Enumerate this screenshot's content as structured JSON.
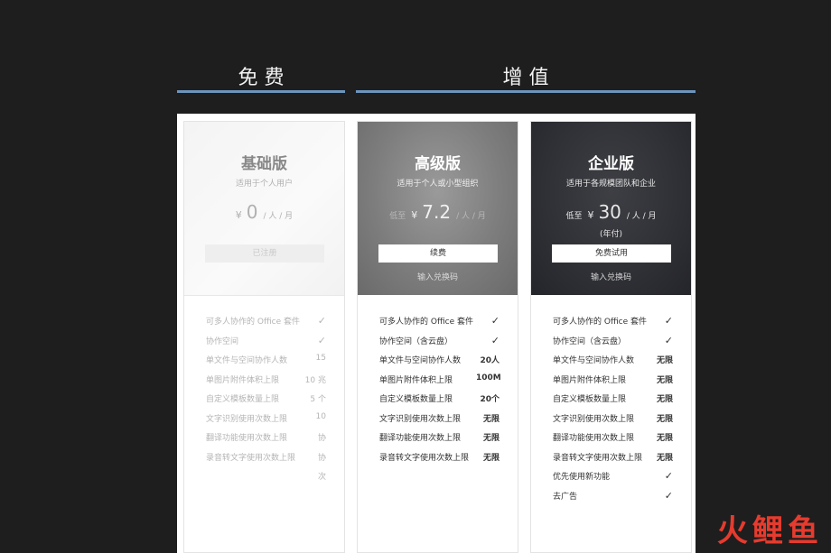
{
  "sections": {
    "free": "免  费",
    "value_added": "增  值"
  },
  "plans": [
    {
      "name": "基础版",
      "subtitle": "适用于个人用户",
      "prefix": "",
      "currency": "¥",
      "price": "0",
      "unit": "/ 人 / 月",
      "billing": "",
      "button": "已注册",
      "link": "",
      "features": [
        {
          "label": "可多人协作的 Office 套件",
          "value": "✓"
        },
        {
          "label": "协作空间",
          "value": "✓"
        },
        {
          "label": "单文件与空间协作人数",
          "value": "15"
        },
        {
          "label": "单图片附件体积上限",
          "value": "10 兆"
        },
        {
          "label": "自定义模板数量上限",
          "value": "5 个"
        },
        {
          "label": "文字识别使用次数上限",
          "value": "10"
        },
        {
          "label": "翻译功能使用次数上限",
          "value": "协"
        },
        {
          "label": "录音转文字使用次数上限",
          "value": "协"
        },
        {
          "label": "",
          "value": "次"
        }
      ]
    },
    {
      "name": "高级版",
      "subtitle": "适用于个人或小型组织",
      "prefix": "低至",
      "currency": "¥",
      "price": "7.2",
      "unit": "/ 人 / 月",
      "billing": "",
      "button": "续费",
      "link": "输入兑换码",
      "features": [
        {
          "label": "可多人协作的 Office 套件",
          "value": "✓"
        },
        {
          "label": "协作空间（含云盘）",
          "value": "✓"
        },
        {
          "label": "单文件与空间协作人数",
          "value": "20人"
        },
        {
          "label": "单图片附件体积上限",
          "value": "100M"
        },
        {
          "label": "自定义模板数量上限",
          "value": "20个"
        },
        {
          "label": "文字识别使用次数上限",
          "value": "无限"
        },
        {
          "label": "翻译功能使用次数上限",
          "value": "无限"
        },
        {
          "label": "录音转文字使用次数上限",
          "value": "无限"
        }
      ]
    },
    {
      "name": "企业版",
      "subtitle": "适用于各规模团队和企业",
      "prefix": "低至",
      "currency": "¥",
      "price": "30",
      "unit": "/ 人 / 月",
      "billing": "(年付)",
      "button": "免费试用",
      "link": "输入兑换码",
      "features": [
        {
          "label": "可多人协作的 Office 套件",
          "value": "✓"
        },
        {
          "label": "协作空间（含云盘）",
          "value": "✓"
        },
        {
          "label": "单文件与空间协作人数",
          "value": "无限"
        },
        {
          "label": "单图片附件体积上限",
          "value": "无限"
        },
        {
          "label": "自定义模板数量上限",
          "value": "无限"
        },
        {
          "label": "文字识别使用次数上限",
          "value": "无限"
        },
        {
          "label": "翻译功能使用次数上限",
          "value": "无限"
        },
        {
          "label": "录音转文字使用次数上限",
          "value": "无限"
        },
        {
          "label": "优先使用新功能",
          "value": "✓"
        },
        {
          "label": "去广告",
          "value": "✓"
        }
      ]
    }
  ],
  "logo": {
    "text": [
      "火",
      "鲤",
      "鱼"
    ],
    "colors": [
      "#e63b2e",
      "#e63b2e",
      "#e63b2e"
    ]
  }
}
